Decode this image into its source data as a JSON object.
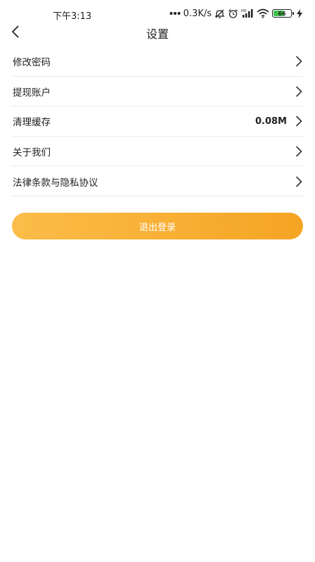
{
  "status_bar": {
    "time": "下午3:13",
    "network_speed": "0.3K/s",
    "battery_level": "66",
    "battery_fraction": 0.66,
    "icons": [
      "dots-icon",
      "mute-icon",
      "alarm-icon",
      "signal-icon",
      "wifi-icon",
      "battery-icon",
      "charging-icon"
    ],
    "battery_color": "#3fc24b"
  },
  "header": {
    "title": "设置",
    "back_icon": "chevron-left-icon"
  },
  "settings": {
    "items": [
      {
        "label": "修改密码",
        "value": ""
      },
      {
        "label": "提现账户",
        "value": ""
      },
      {
        "label": "清理缓存",
        "value": "0.08M"
      },
      {
        "label": "关于我们",
        "value": ""
      },
      {
        "label": "法律条款与隐私协议",
        "value": ""
      }
    ],
    "chevron_icon": "chevron-right-icon"
  },
  "logout": {
    "label": "退出登录",
    "gradient_start": "#fbbd49",
    "gradient_end": "#f5a423"
  }
}
